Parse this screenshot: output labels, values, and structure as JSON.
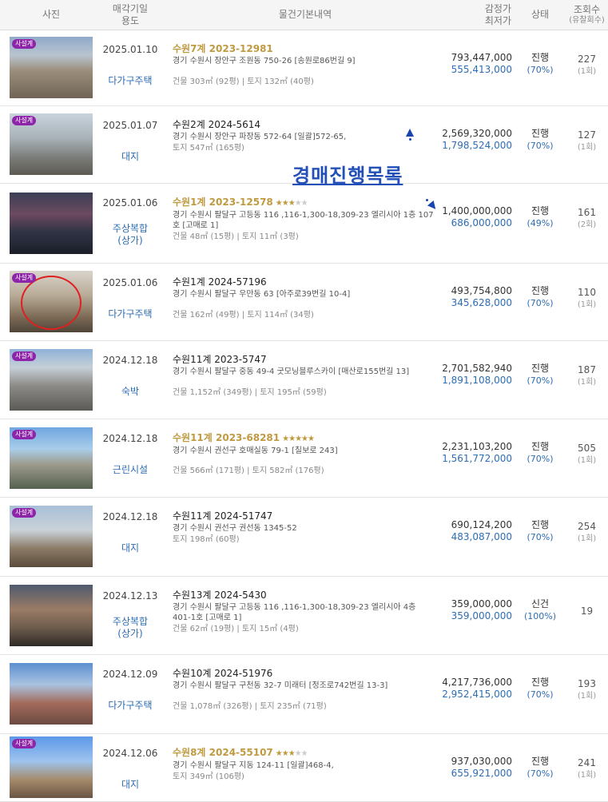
{
  "header": {
    "photo": "사진",
    "date_line1": "매각기일",
    "date_line2": "용도",
    "info": "물건기본내역",
    "price_line1": "감정가",
    "price_line2": "최저가",
    "status": "상태",
    "views_line1": "조회수",
    "views_line2": "(유찰회수)"
  },
  "overlay": {
    "title": "경매진행목록"
  },
  "badge_label": "사설계",
  "rows": [
    {
      "date": "2025.01.10",
      "usage": "다가구주택",
      "case": "수원7계 2023-12981",
      "case_highlight": true,
      "stars": 0,
      "addr": "경기 수원시 장안구 조원동 750-26 [송원로86번길 9]",
      "area": "건물 303㎡ (92평)  |  토지 132㎡ (40평)",
      "appraisal": "793,447,000",
      "minimum": "555,413,000",
      "status": "진행",
      "pct": "(70%)",
      "views": "227",
      "fails": "(1회)",
      "badge": true
    },
    {
      "date": "2025.01.07",
      "usage": "대지",
      "case": "수원2계 2024-5614",
      "case_highlight": false,
      "stars": 0,
      "addr": "경기 수원시 장안구 파장동 572-64  [일괄]572-65,",
      "area": "토지 547㎡ (165평)",
      "appraisal": "2,569,320,000",
      "minimum": "1,798,524,000",
      "status": "진행",
      "pct": "(70%)",
      "views": "127",
      "fails": "(1회)",
      "badge": true
    },
    {
      "date": "2025.01.06",
      "usage": "주상복합",
      "usage2": "(상가)",
      "case": "수원1계 2023-12578",
      "case_highlight": true,
      "stars": 3,
      "addr": "경기 수원시 팔달구 고등동 116 ,116-1,300-18,309-23 엘리시아 1층 107호 [고매로 1]",
      "area": "건물 48㎡ (15평)  |  토지 11㎡ (3평)",
      "appraisal": "1,400,000,000",
      "minimum": "686,000,000",
      "status": "진행",
      "pct": "(49%)",
      "views": "161",
      "fails": "(2회)",
      "badge": false
    },
    {
      "date": "2025.01.06",
      "usage": "다가구주택",
      "case": "수원1계 2024-57196",
      "case_highlight": false,
      "stars": 0,
      "addr": "경기 수원시 팔달구 우만동 63 [아주로39번길 10-4]",
      "area": "건물 162㎡ (49평)  |  토지 114㎡ (34평)",
      "appraisal": "493,754,800",
      "minimum": "345,628,000",
      "status": "진행",
      "pct": "(70%)",
      "views": "110",
      "fails": "(1회)",
      "badge": true
    },
    {
      "date": "2024.12.18",
      "usage": "숙박",
      "case": "수원11계 2023-5747",
      "case_highlight": false,
      "stars": 0,
      "addr": "경기 수원시 팔달구 중동 49-4 굿모닝블루스카이 [매산로155번길 13]",
      "area": "건물 1,152㎡ (349평)  |  토지 195㎡ (59평)",
      "appraisal": "2,701,582,940",
      "minimum": "1,891,108,000",
      "status": "진행",
      "pct": "(70%)",
      "views": "187",
      "fails": "(1회)",
      "badge": true
    },
    {
      "date": "2024.12.18",
      "usage": "근린시설",
      "case": "수원11계 2023-68281",
      "case_highlight": true,
      "stars": 5,
      "addr": "경기 수원시 권선구 호매실동 79-1 [칠보로 243]",
      "area": "건물 566㎡ (171평)  |  토지 582㎡ (176평)",
      "appraisal": "2,231,103,200",
      "minimum": "1,561,772,000",
      "status": "진행",
      "pct": "(70%)",
      "views": "505",
      "fails": "(1회)",
      "badge": true
    },
    {
      "date": "2024.12.18",
      "usage": "대지",
      "case": "수원11계 2024-51747",
      "case_highlight": false,
      "stars": 0,
      "addr": "경기 수원시 권선구 권선동 1345-52",
      "area": "토지 198㎡ (60평)",
      "appraisal": "690,124,200",
      "minimum": "483,087,000",
      "status": "진행",
      "pct": "(70%)",
      "views": "254",
      "fails": "(1회)",
      "badge": true
    },
    {
      "date": "2024.12.13",
      "usage": "주상복합",
      "usage2": "(상가)",
      "case": "수원13계 2024-5430",
      "case_highlight": false,
      "stars": 0,
      "addr": "경기 수원시 팔달구 고등동 116 ,116-1,300-18,309-23 엘리시아 4층 401-1호 [고매로 1]",
      "area": "건물 62㎡ (19평)  |  토지 15㎡ (4평)",
      "appraisal": "359,000,000",
      "minimum": "359,000,000",
      "status": "신건",
      "pct": "(100%)",
      "views": "19",
      "fails": "",
      "badge": false
    },
    {
      "date": "2024.12.09",
      "usage": "다가구주택",
      "case": "수원10계 2024-51976",
      "case_highlight": false,
      "stars": 0,
      "addr": "경기 수원시 팔달구 구천동 32-7 미래터 [정조로742번길 13-3]",
      "area": "건물 1,078㎡ (326평)  |  토지 235㎡ (71평)",
      "appraisal": "4,217,736,000",
      "minimum": "2,952,415,000",
      "status": "진행",
      "pct": "(70%)",
      "views": "193",
      "fails": "(1회)",
      "badge": false
    },
    {
      "date": "2024.12.06",
      "usage": "대지",
      "case": "수원8계 2024-55107",
      "case_highlight": true,
      "stars": 3,
      "addr": "경기 수원시 팔달구 지동 124-11  [일괄]468-4,",
      "area": "토지 349㎡ (106평)",
      "appraisal": "937,030,000",
      "minimum": "655,921,000",
      "status": "진행",
      "pct": "(70%)",
      "views": "241",
      "fails": "(1회)",
      "badge": true
    }
  ]
}
